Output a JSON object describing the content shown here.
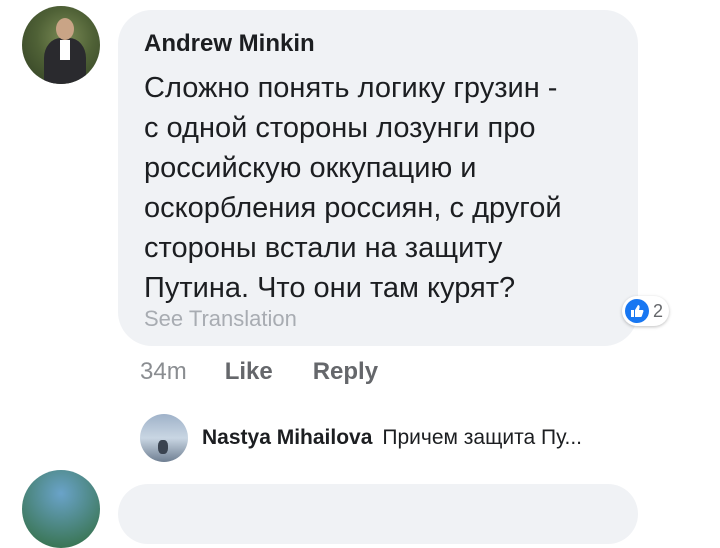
{
  "comment": {
    "author": "Andrew Minkin",
    "text": "Сложно понять логику грузин -\nс одной стороны лозунги про\nроссийскую оккупацию и\nоскорбления россиян, с другой\nстороны встали на защиту\nПутина. Что они там курят?",
    "see_translation": "See Translation",
    "reaction_icon": "thumbs-up-icon",
    "reaction_count": "2",
    "time": "34m",
    "like_label": "Like",
    "reply_label": "Reply"
  },
  "reply": {
    "author": "Nastya Mihailova",
    "preview": "Причем защита Пу..."
  },
  "colors": {
    "bubble": "#f0f2f5",
    "like_blue": "#1877f2",
    "secondary_text": "#65676b"
  }
}
